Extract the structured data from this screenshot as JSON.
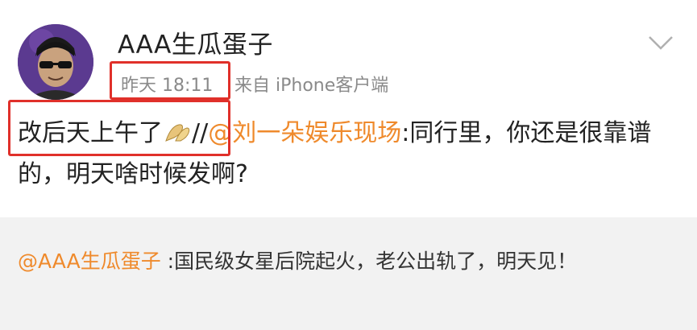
{
  "post": {
    "username": "AAA生瓜蛋子",
    "time": "昨天 18:11",
    "source": "来自 iPhone客户端",
    "reply_text": "改后天上午了",
    "emoji": "hands-emoji",
    "separator": "//",
    "quoted_mention": "@刘一朵娱乐现场",
    "quoted_text": ":同行里，你还是很靠谱的，明天啥时候发啊?"
  },
  "repost": {
    "mention": "@AAA生瓜蛋子",
    "text": " :国民级女星后院起火，老公出轨了，明天见！"
  },
  "colors": {
    "highlight": "#e0302a",
    "mention": "#ef8a2c",
    "meta": "#8a8a8a",
    "repost_bg": "#f2f2f2"
  }
}
